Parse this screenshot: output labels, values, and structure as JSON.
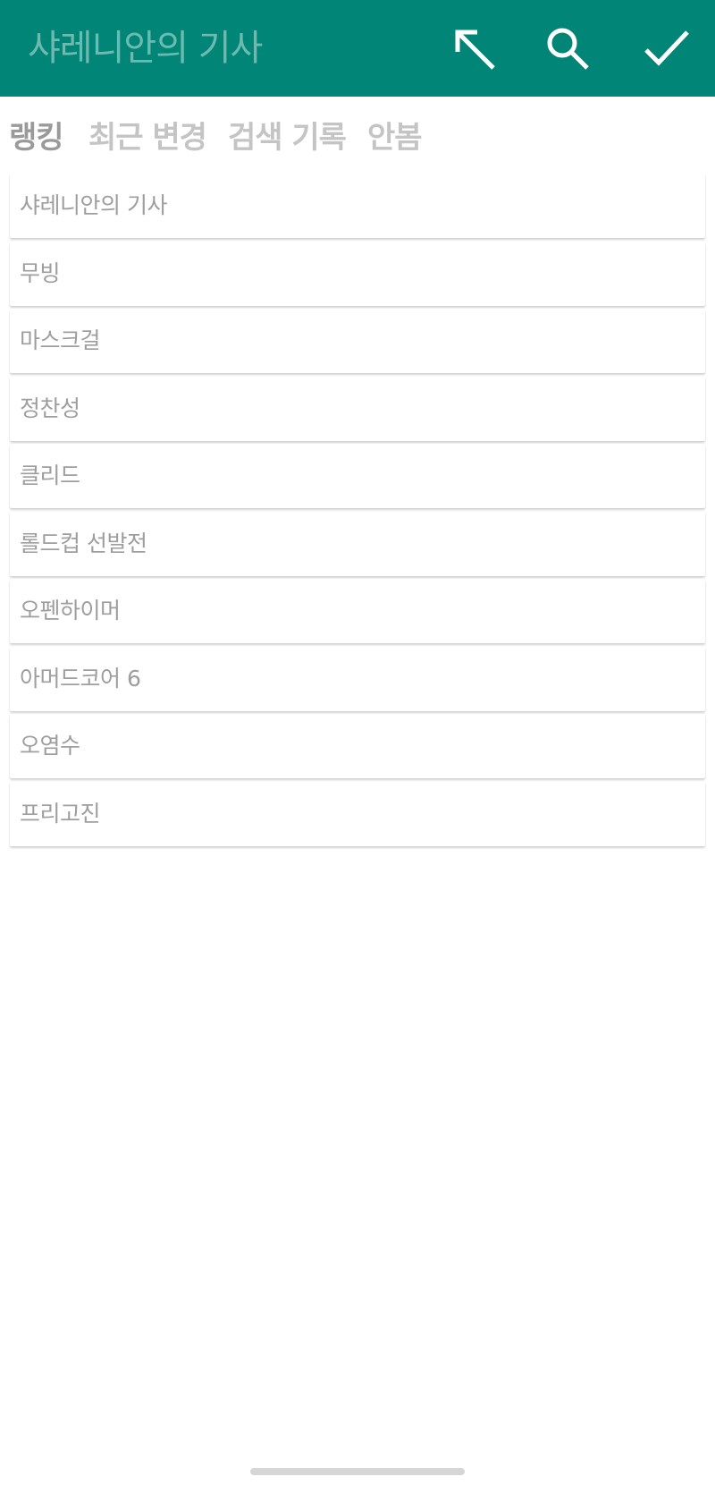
{
  "appbar": {
    "title": "샤레니안의 기사",
    "color": "#008577",
    "actions": [
      {
        "name": "open-top-left-icon",
        "icon": "arrow-up-left-icon"
      },
      {
        "name": "search-icon",
        "icon": "search-icon"
      },
      {
        "name": "check-icon",
        "icon": "check-icon"
      }
    ]
  },
  "tabs": [
    {
      "label": "랭킹",
      "active": true
    },
    {
      "label": "최근 변경",
      "active": false
    },
    {
      "label": "검색 기록",
      "active": false
    },
    {
      "label": "안봄",
      "active": false
    }
  ],
  "list": {
    "items": [
      {
        "label": "샤레니안의 기사"
      },
      {
        "label": "무빙"
      },
      {
        "label": "마스크걸"
      },
      {
        "label": "정찬성"
      },
      {
        "label": "클리드"
      },
      {
        "label": "롤드컵 선발전"
      },
      {
        "label": "오펜하이머"
      },
      {
        "label": "아머드코어 6"
      },
      {
        "label": "오염수"
      },
      {
        "label": "프리고진"
      }
    ]
  }
}
